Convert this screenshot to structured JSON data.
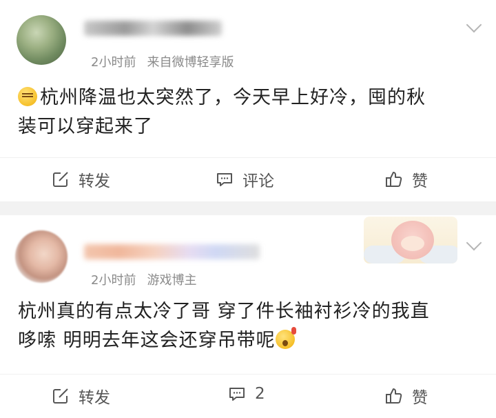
{
  "posts": [
    {
      "time": "2小时前",
      "source": "来自微博轻享版",
      "content_line1": "杭州降温也太突然了，今天早上好冷，囤的秋",
      "content_line2": "装可以穿起来了",
      "actions": {
        "repost": "转发",
        "comment": "评论",
        "like": "赞"
      }
    },
    {
      "time": "2小时前",
      "source": "游戏博主",
      "content_line1": "杭州真的有点太冷了哥  穿了件长袖衬衫冷的我直",
      "content_line2": "哆嗦  明明去年这会还穿吊带呢",
      "actions": {
        "repost": "转发",
        "comment": "2",
        "like": "赞"
      }
    }
  ],
  "icons": {
    "repost": "share-edit-icon",
    "comment": "comment-bubble-icon",
    "like": "thumbs-up-icon",
    "menu": "chevron-down-icon"
  },
  "colors": {
    "meta": "#8a8a8a",
    "separator": "#f2f2f2",
    "text": "#222222"
  }
}
